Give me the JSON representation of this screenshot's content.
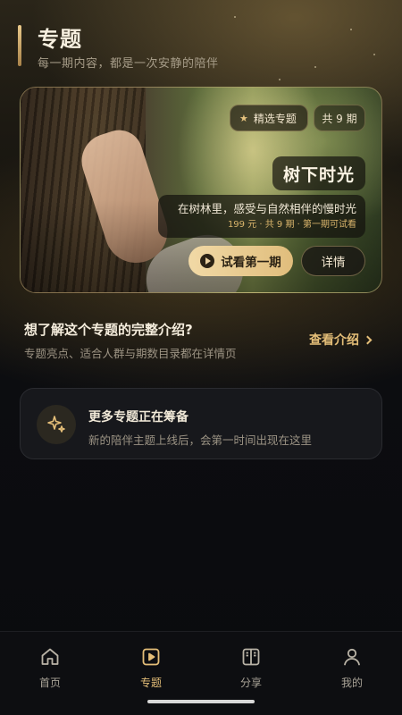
{
  "header": {
    "title": "专题",
    "subtitle": "每一期内容，都是一次安静的陪伴"
  },
  "hero": {
    "featured_tag": "精选专题",
    "episode_count_tag": "共 9 期",
    "title": "树下时光",
    "description": "在树林里，感受与自然相伴的慢时光",
    "meta": "199 元 · 共 9 期 · 第一期可试看",
    "trial_button": "试看第一期",
    "detail_button": "详情"
  },
  "intro": {
    "title": "想了解这个专题的完整介绍?",
    "subtitle": "专题亮点、适合人群与期数目录都在详情页",
    "link": "查看介绍"
  },
  "more": {
    "title": "更多专题正在筹备",
    "subtitle": "新的陪伴主题上线后，会第一时间出现在这里"
  },
  "nav": {
    "items": [
      {
        "label": "首页",
        "icon": "home-icon"
      },
      {
        "label": "专题",
        "icon": "play-square-icon",
        "active": true
      },
      {
        "label": "分享",
        "icon": "book-icon"
      },
      {
        "label": "我的",
        "icon": "user-icon"
      }
    ]
  },
  "colors": {
    "accent": "#e4be78",
    "background": "#0a0b0e"
  }
}
